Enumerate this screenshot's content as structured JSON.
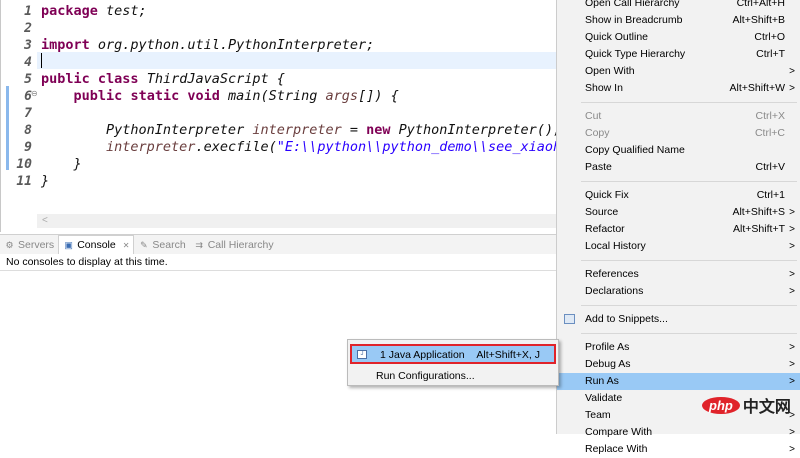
{
  "editor": {
    "lines": [
      {
        "n": "1",
        "segs": [
          [
            "package",
            "kw"
          ],
          [
            " test;",
            ""
          ]
        ]
      },
      {
        "n": "2",
        "segs": []
      },
      {
        "n": "3",
        "segs": [
          [
            "import",
            "kw"
          ],
          [
            " org.python.util.PythonInterpreter;",
            ""
          ]
        ]
      },
      {
        "n": "4",
        "segs": []
      },
      {
        "n": "5",
        "segs": [
          [
            "public",
            "kw"
          ],
          [
            " ",
            ""
          ],
          [
            "class",
            "kw"
          ],
          [
            " ThirdJavaScript {",
            ""
          ]
        ]
      },
      {
        "n": "6",
        "segs": [
          [
            "    ",
            ""
          ],
          [
            "public",
            "kw"
          ],
          [
            " ",
            ""
          ],
          [
            "static",
            "kw"
          ],
          [
            " ",
            ""
          ],
          [
            "void",
            "kw"
          ],
          [
            " main(String ",
            ""
          ],
          [
            "args",
            "var"
          ],
          [
            "[]) {",
            ""
          ]
        ]
      },
      {
        "n": "7",
        "segs": []
      },
      {
        "n": "8",
        "segs": [
          [
            "        PythonInterpreter ",
            ""
          ],
          [
            "interpreter",
            "var"
          ],
          [
            " = ",
            ""
          ],
          [
            "new",
            "kw"
          ],
          [
            " PythonInterpreter();",
            ""
          ]
        ]
      },
      {
        "n": "9",
        "segs": [
          [
            "        ",
            ""
          ],
          [
            "interpreter",
            "var"
          ],
          [
            ".execfile(",
            ""
          ],
          [
            "\"E:\\\\python\\\\python_demo\\\\see_xiaohua.",
            "str"
          ]
        ]
      },
      {
        "n": "10",
        "segs": [
          [
            "    }",
            ""
          ]
        ]
      },
      {
        "n": "11",
        "segs": [
          [
            "}",
            ""
          ]
        ]
      }
    ],
    "hscroll_arrow": "<"
  },
  "bottom": {
    "tabs": [
      {
        "icon": "servers-icon",
        "glyph": "⚙",
        "label": "Servers",
        "active": false
      },
      {
        "icon": "console-icon",
        "glyph": "▣",
        "label": "Console",
        "active": true,
        "close": "✕"
      },
      {
        "icon": "search-icon",
        "glyph": "✎",
        "label": "Search",
        "active": false
      },
      {
        "icon": "call-hierarchy-icon",
        "glyph": "⇉",
        "label": "Call Hierarchy",
        "active": false
      }
    ],
    "message": "No consoles to display at this time."
  },
  "context_menu": {
    "items": [
      {
        "label": "Open Call Hierarchy",
        "shortcut": "Ctrl+Alt+H"
      },
      {
        "label": "Show in Breadcrumb",
        "shortcut": "Alt+Shift+B"
      },
      {
        "label": "Quick Outline",
        "shortcut": "Ctrl+O"
      },
      {
        "label": "Quick Type Hierarchy",
        "shortcut": "Ctrl+T"
      },
      {
        "label": "Open With",
        "shortcut": "",
        "submenu": true
      },
      {
        "label": "Show In",
        "shortcut": "Alt+Shift+W",
        "submenu": true
      },
      {
        "sep": true
      },
      {
        "label": "Cut",
        "shortcut": "Ctrl+X",
        "disabled": true
      },
      {
        "label": "Copy",
        "shortcut": "Ctrl+C",
        "disabled": true
      },
      {
        "label": "Copy Qualified Name",
        "shortcut": ""
      },
      {
        "label": "Paste",
        "shortcut": "Ctrl+V"
      },
      {
        "sep": true
      },
      {
        "label": "Quick Fix",
        "shortcut": "Ctrl+1"
      },
      {
        "label": "Source",
        "shortcut": "Alt+Shift+S",
        "submenu": true
      },
      {
        "label": "Refactor",
        "shortcut": "Alt+Shift+T",
        "submenu": true
      },
      {
        "label": "Local History",
        "shortcut": "",
        "submenu": true
      },
      {
        "sep": true
      },
      {
        "label": "References",
        "shortcut": "",
        "submenu": true
      },
      {
        "label": "Declarations",
        "shortcut": "",
        "submenu": true
      },
      {
        "sep": true
      },
      {
        "label": "Add to Snippets...",
        "shortcut": "",
        "icon": "snippets-icon"
      },
      {
        "sep": true
      },
      {
        "label": "Profile As",
        "shortcut": "",
        "submenu": true
      },
      {
        "label": "Debug As",
        "shortcut": "",
        "submenu": true
      },
      {
        "label": "Run As",
        "shortcut": "",
        "submenu": true,
        "highlighted": true
      },
      {
        "label": "Validate",
        "shortcut": ""
      },
      {
        "label": "Team",
        "shortcut": "",
        "submenu": true
      },
      {
        "label": "Compare With",
        "shortcut": "",
        "submenu": true
      },
      {
        "label": "Replace With",
        "shortcut": "",
        "submenu": true
      }
    ],
    "submenu_arrow": ">"
  },
  "run_as_submenu": {
    "items": [
      {
        "label": "1 Java Application",
        "shortcut": "Alt+Shift+X, J",
        "icon_text": "J"
      },
      {
        "label": "Run Configurations..."
      }
    ]
  },
  "watermark": {
    "php": "php",
    "cn": "中文网"
  },
  "colors": {
    "highlight": "#99c9f5",
    "annotation_box": "#e0232a",
    "keyword": "#7f0055",
    "string": "#2a00ff"
  }
}
